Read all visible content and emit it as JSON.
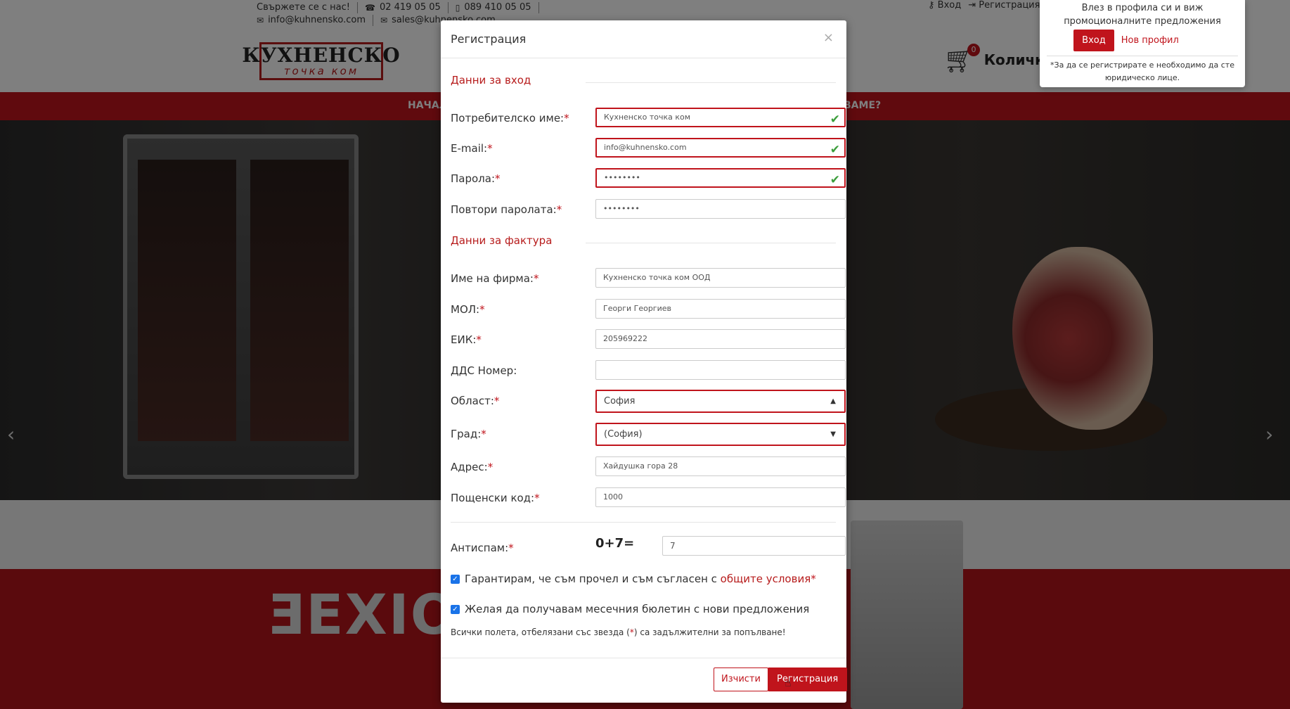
{
  "site": {
    "contact_label": "Свържете се с нас!",
    "phone1": "02 419 05 05",
    "phone2": "089 410 05 05",
    "email1": "info@kuhnensko.com",
    "email2": "sales@kuhnensko.com",
    "logo_top": "КУХНЕНСКО",
    "logo_bottom": "точка ком",
    "login_link": "Вход",
    "register_link": "Регистрация",
    "cart_count": "0",
    "cart_label": "Количка",
    "nav_left": "НАЧАЛ",
    "nav_right": "ВАМЕ?",
    "brand": "ƎEXIO"
  },
  "popover": {
    "message": "Влез в профила си и виж промоционалните предложения",
    "login_button": "Вход",
    "new_profile": "Нов профил",
    "note": "*За да се регистрирате е необходимо да сте юридическо лице."
  },
  "modal": {
    "title": "Регистрация",
    "close": "×",
    "section_login": "Данни за вход",
    "section_invoice": "Данни за фактура",
    "fields": {
      "username": {
        "label": "Потребителско име:",
        "value": "Кухненско точка ком"
      },
      "email": {
        "label": "E-mail:",
        "value": "info@kuhnensko.com"
      },
      "password": {
        "label": "Парола:",
        "value": "••••••••"
      },
      "password_repeat": {
        "label": "Повтори паролата:",
        "value": "••••••••"
      },
      "company": {
        "label": "Име на фирма:",
        "value": "Кухненско точка ком ООД"
      },
      "mol": {
        "label": "МОЛ:",
        "value": "Георги Георгиев"
      },
      "eik": {
        "label": "ЕИК:",
        "value": "205969222"
      },
      "vat": {
        "label": "ДДС Номер:",
        "value": ""
      },
      "region": {
        "label": "Област:",
        "value": "София"
      },
      "city": {
        "label": "Град:",
        "value": "(София)"
      },
      "address": {
        "label": "Адрес:",
        "value": "Хайдушка гора 28"
      },
      "postcode": {
        "label": "Пощенски код:",
        "value": "1000"
      }
    },
    "antispam": {
      "label": "Антиспам:",
      "question": "0+7=",
      "value": "7"
    },
    "terms_text": "Гарантирам, че съм прочел и съм съгласен с ",
    "terms_link": "общите условия",
    "newsletter_text": "Желая да получавам месечния бюлетин с нови предложения",
    "required_note_a": "Всички полета, отбелязани със звезда (",
    "required_note_b": ") са задължителни за попълване!",
    "required_mark": "*",
    "clear_button": "Изчисти",
    "register_button": "Регистрация"
  }
}
